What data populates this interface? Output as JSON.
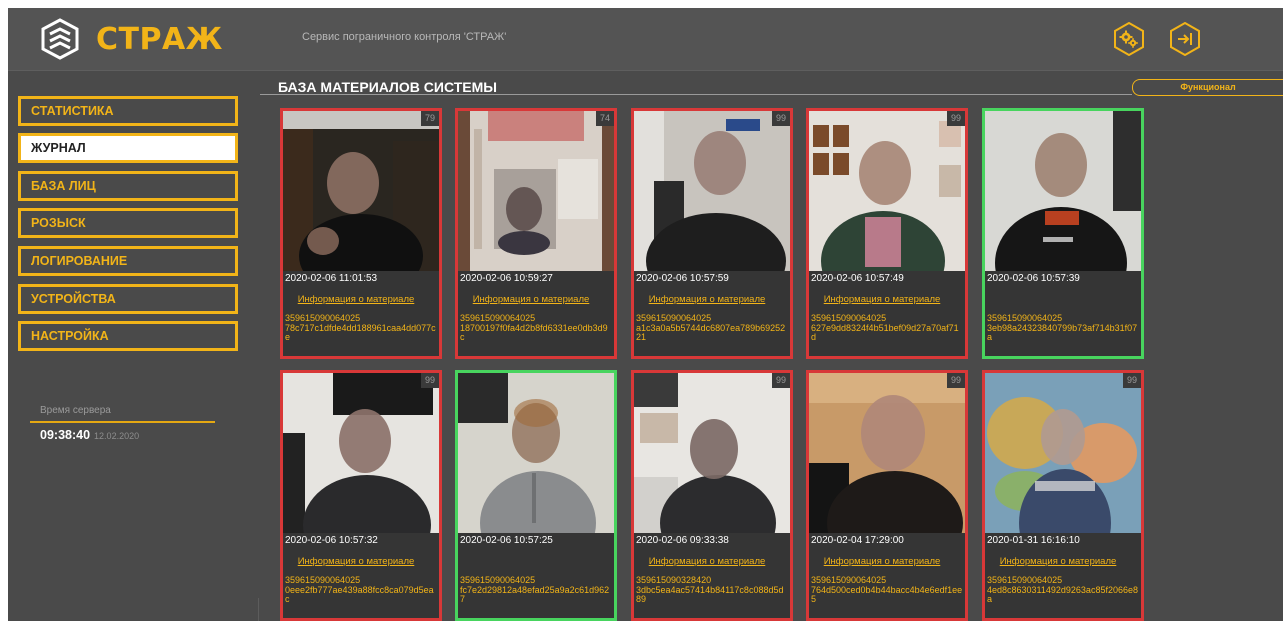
{
  "app": {
    "logo_text": "СТРАЖ",
    "service_title": "Сервис пограничного контроля 'СТРАЖ'",
    "colors": {
      "accent": "#f2b418",
      "background": "#4a4a4a",
      "header": "#545454",
      "card_red": "#d83838",
      "card_green": "#48d45e"
    }
  },
  "header": {
    "icons": [
      "shield-chevrons-icon",
      "gear-icon",
      "exit-icon"
    ]
  },
  "sidebar": {
    "items": [
      {
        "label": "СТАТИСТИКА"
      },
      {
        "label": "ЖУРНАЛ"
      },
      {
        "label": "БАЗА ЛИЦ"
      },
      {
        "label": "РОЗЫСК"
      },
      {
        "label": "ЛОГИРОВАНИЕ"
      },
      {
        "label": "УСТРОЙСТВА"
      },
      {
        "label": "НАСТРОЙКА"
      }
    ],
    "active_item": "ЖУРНАЛ",
    "server_time_label": "Время сервера",
    "server_time": "09:38:40",
    "server_date": "12.02.2020"
  },
  "main": {
    "title": "БАЗА МАТЕРИАЛОВ СИСТЕМЫ",
    "functional_button": "Функционал",
    "cards": [
      {
        "score": "79",
        "time": "2020-02-06 11:01:53",
        "link": "Информация о материале",
        "device": "359615090064025",
        "hash": "78c717c1dfde4dd188961caa4dd077ce",
        "status": "red"
      },
      {
        "score": "74",
        "time": "2020-02-06 10:59:27",
        "link": "Информация о материале",
        "device": "359615090064025",
        "hash": "18700197f0fa4d2b8fd6331ee0db3d9c",
        "status": "red"
      },
      {
        "score": "99",
        "time": "2020-02-06 10:57:59",
        "link": "Информация о материале",
        "device": "359615090064025",
        "hash": "a1c3a0a5b5744dc6807ea789b6925221",
        "status": "red"
      },
      {
        "score": "99",
        "time": "2020-02-06 10:57:49",
        "link": "Информация о материале",
        "device": "359615090064025",
        "hash": "627e9dd8324f4b51bef09d27a70af71d",
        "status": "red"
      },
      {
        "score": "",
        "time": "2020-02-06 10:57:39",
        "link": "",
        "device": "359615090064025",
        "hash": "3eb98a24323840799b73af714b31f07a",
        "status": "green"
      },
      {
        "score": "99",
        "time": "2020-02-06 10:57:32",
        "link": "Информация о материале",
        "device": "359615090064025",
        "hash": "0eee2fb777ae439a88fcc8ca079d5eac",
        "status": "red"
      },
      {
        "score": "",
        "time": "2020-02-06 10:57:25",
        "link": "",
        "device": "359615090064025",
        "hash": "fc7e2d29812a48efad25a9a2c61d9627",
        "status": "green"
      },
      {
        "score": "99",
        "time": "2020-02-06 09:33:38",
        "link": "Информация о материале",
        "device": "359615090328420",
        "hash": "3dbc5ea4ac57414b84117c8c088d5d89",
        "status": "red"
      },
      {
        "score": "99",
        "time": "2020-02-04 17:29:00",
        "link": "Информация о материале",
        "device": "359615090064025",
        "hash": "764d500ced0b4b44bacc4b4e6edf1ee5",
        "status": "red"
      },
      {
        "score": "99",
        "time": "2020-01-31 16:16:10",
        "link": "Информация о материале",
        "device": "359615090064025",
        "hash": "4ed8c8630311492d9263ac85f2066e8a",
        "status": "red"
      }
    ]
  }
}
